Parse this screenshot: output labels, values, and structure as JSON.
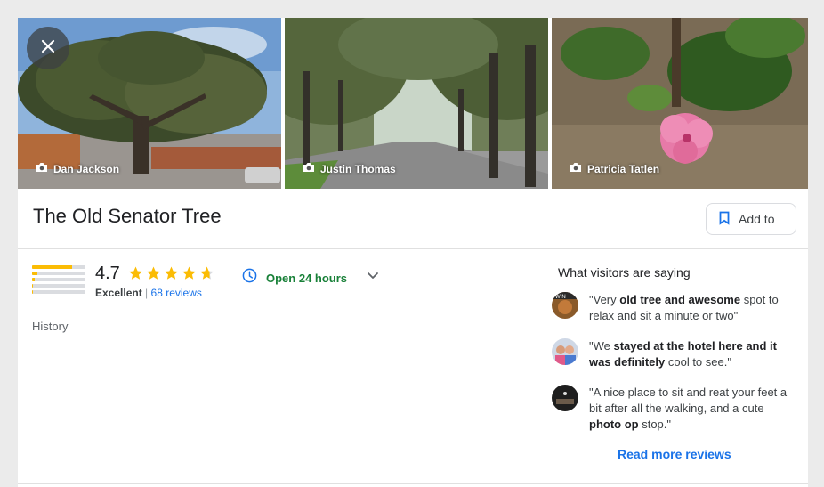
{
  "photos": [
    {
      "credit": "Dan Jackson",
      "icon": "camera-icon"
    },
    {
      "credit": "Justin Thomas",
      "icon": "camera-icon"
    },
    {
      "credit": "Patricia Tatlen",
      "icon": "camera-icon"
    }
  ],
  "close_icon": "close-icon",
  "place": {
    "title": "The Old Senator Tree",
    "save_label": "Add to",
    "category": "History"
  },
  "rating": {
    "value": "4.7",
    "stars": 4.7,
    "label": "Excellent",
    "separator": "|",
    "reviews": "68 reviews",
    "distribution": [
      0.75,
      0.1,
      0.05,
      0.02,
      0.02
    ]
  },
  "hours": {
    "text": "Open 24 hours",
    "icon": "clock-icon"
  },
  "visitors": {
    "title": "What visitors are saying",
    "reviews": [
      {
        "parts": [
          "\"Very ",
          "old tree and awesome",
          " spot to relax and sit a minute or two\""
        ]
      },
      {
        "parts": [
          "\"We ",
          "stayed at the hotel here and it was definitely",
          " cool to see.\""
        ]
      },
      {
        "parts": [
          "\"A nice place to sit and reat your feet a bit after all the walking, and a cute ",
          "photo op",
          " stop.\""
        ]
      }
    ],
    "read_more": "Read more reviews"
  },
  "colors": {
    "accent": "#1a73e8",
    "open": "#188038",
    "star": "#fbbc04"
  }
}
